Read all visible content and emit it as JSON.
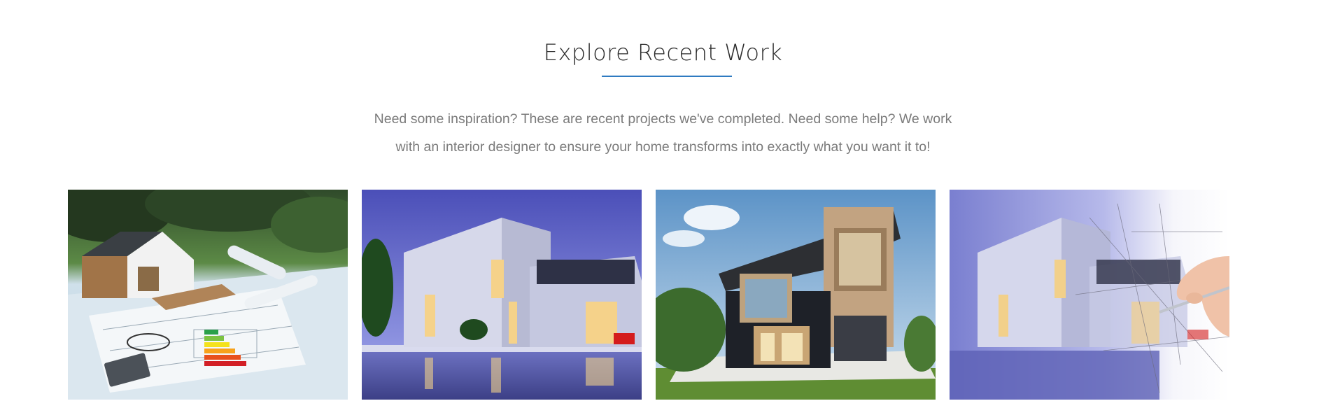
{
  "section": {
    "title": "Explore Recent Work",
    "accent_color": "#2f7bc1",
    "intro_line1": "Need some inspiration? These are recent projects we've completed. Need some help? We work",
    "intro_line2": "with an interior designer to ensure your home transforms into exactly what you want it to!"
  },
  "gallery": {
    "items": [
      {
        "icon": "house-blueprint-model-image"
      },
      {
        "icon": "modern-white-villa-pool-image"
      },
      {
        "icon": "modern-wood-glass-house-image"
      },
      {
        "icon": "villa-sketch-hand-drawing-image"
      }
    ]
  }
}
